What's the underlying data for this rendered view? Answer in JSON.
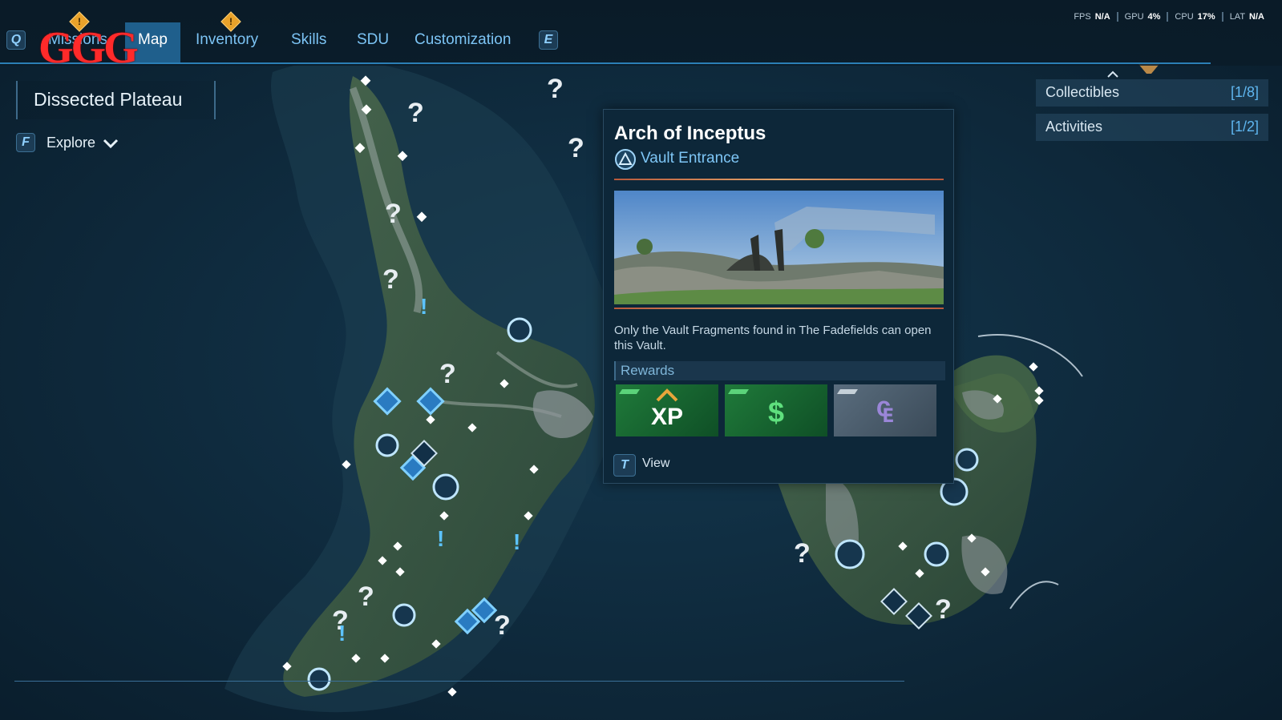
{
  "header": {
    "key_left": "Q",
    "key_right": "E",
    "tabs": [
      {
        "label": "Missions",
        "active": false
      },
      {
        "label": "Map",
        "active": true
      },
      {
        "label": "Inventory",
        "active": false
      },
      {
        "label": "Skills",
        "active": false
      },
      {
        "label": "SDU",
        "active": false
      },
      {
        "label": "Customization",
        "active": false
      }
    ],
    "logo_text": "GGG",
    "alert_glyph": "!"
  },
  "stats": [
    {
      "label": "FPS",
      "value": "N/A"
    },
    {
      "label": "GPU",
      "value": "4%"
    },
    {
      "label": "CPU",
      "value": "17%"
    },
    {
      "label": "LAT",
      "value": "N/A"
    }
  ],
  "region": {
    "title": "Dissected Plateau"
  },
  "explore": {
    "key": "F",
    "label": "Explore"
  },
  "right_panel": [
    {
      "label": "Collectibles",
      "count": "[1/8]"
    },
    {
      "label": "Activities",
      "count": "[1/2]"
    }
  ],
  "popup": {
    "title": "Arch of Inceptus",
    "subtitle": "Vault Entrance",
    "description": "Only the Vault Fragments found in The Fadefields can open this Vault.",
    "rewards_label": "Rewards",
    "rewards": [
      {
        "kind": "xp",
        "text": "XP"
      },
      {
        "kind": "cash",
        "text": "$"
      },
      {
        "kind": "eridium",
        "text": "₠"
      }
    ],
    "view_key": "T",
    "view_label": "View"
  },
  "colors": {
    "accent": "#2b7fb6",
    "active_tab": "#1f5f8c",
    "tab_text": "#7cc4f5",
    "reward_green": "#1f7a3a"
  }
}
